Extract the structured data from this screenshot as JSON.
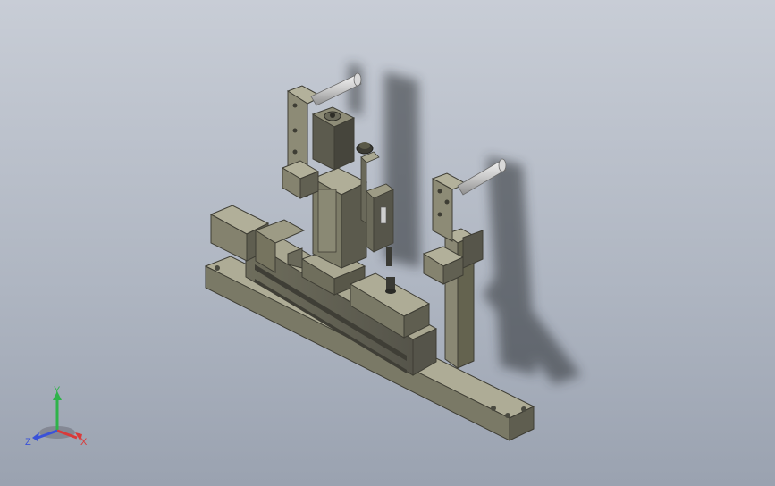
{
  "triad": {
    "y_label": "Y",
    "x_label": "X",
    "z_label": "Z",
    "colors": {
      "y": "#2fb34a",
      "x": "#d93a3a",
      "z": "#3a52d9"
    }
  },
  "colors": {
    "background_top": "#c8cdd6",
    "background_bottom": "#9aa2b0",
    "part_body": "#8f8d78",
    "part_dark": "#5f5e50",
    "part_light": "#b4b29c",
    "shaft": "#d9d9d9",
    "shadow": "#2a2d33"
  }
}
